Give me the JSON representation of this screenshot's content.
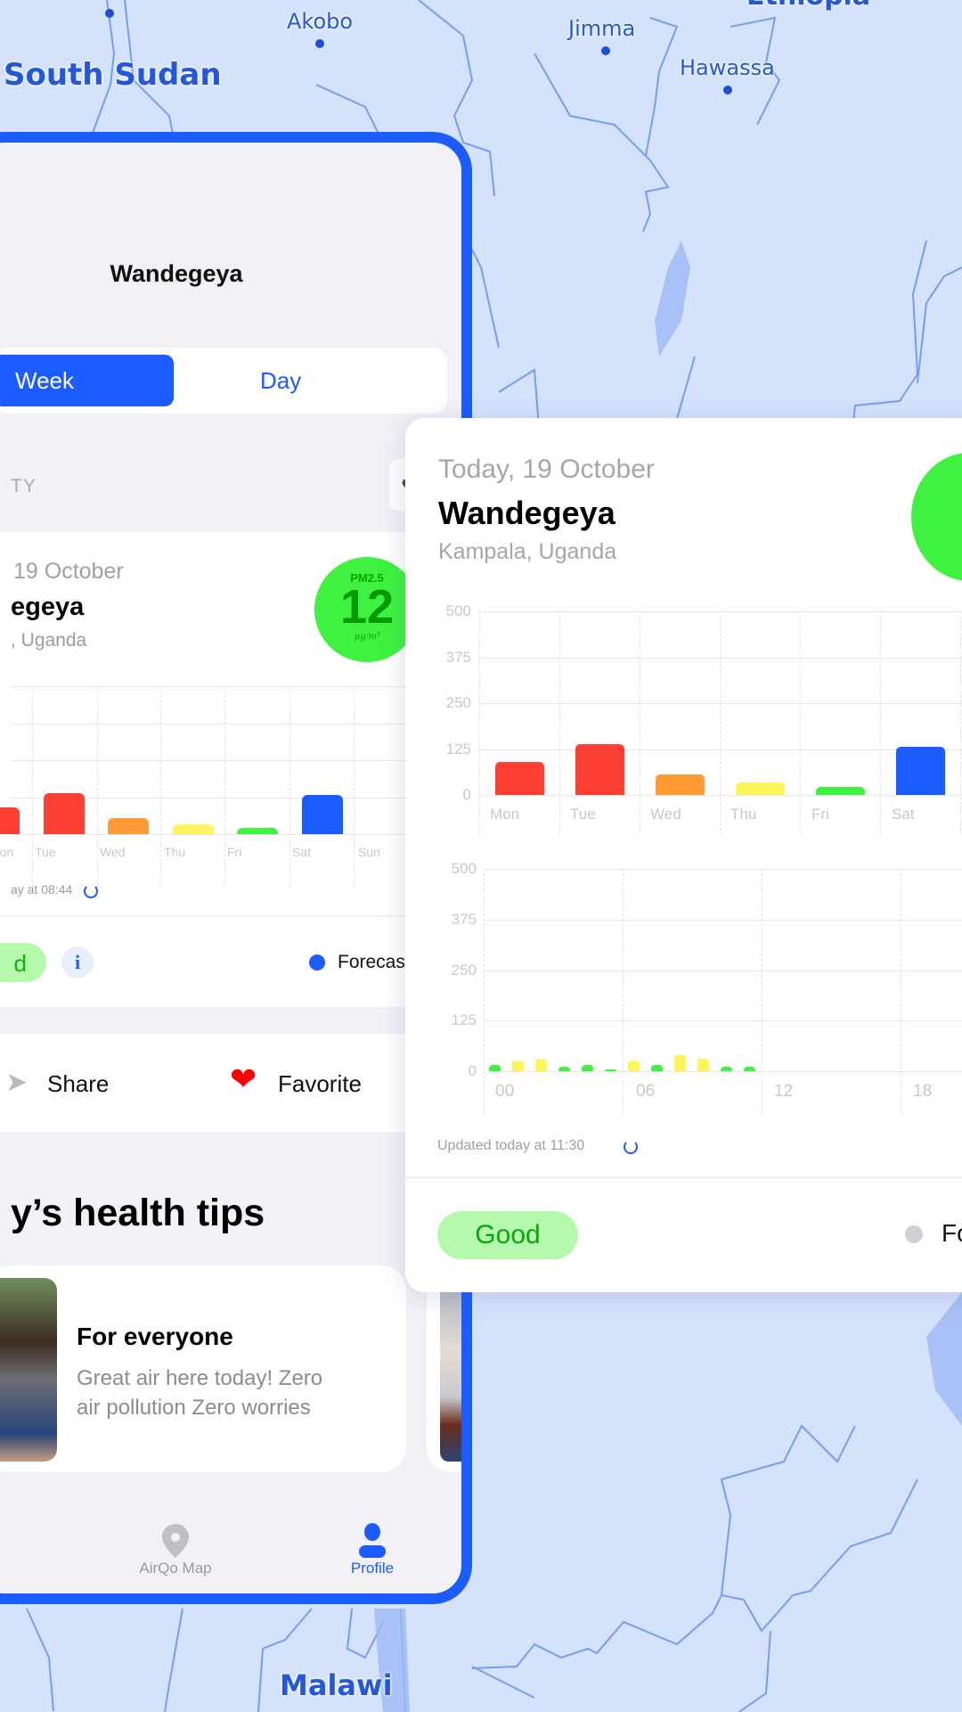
{
  "map": {
    "labels": {
      "south_sudan": "South Sudan",
      "akobo": "Akobo",
      "jimma": "Jimma",
      "hawassa": "Hawassa",
      "ethiopia": "Ethiopia",
      "malawi": "Malawi"
    },
    "colors": {
      "water": "#d5e2fc",
      "border": "#5f8cf0",
      "label": "#2458d8"
    }
  },
  "phone": {
    "location_title": "Wandegeya",
    "toggle": {
      "week": "Week",
      "day": "Day",
      "selected": "Week"
    },
    "section_label": "TY",
    "card": {
      "date": "19 October",
      "name": "egeya",
      "region": ", Uganda",
      "pm_label": "PM2.5",
      "pm_value": "12",
      "pm_unit": "µg/m³",
      "updated": "ay at 08:44",
      "status": "d",
      "forecast": "Forecast"
    },
    "actions": {
      "share": "Share",
      "favorite": "Favorite"
    },
    "tips_heading": "y’s health tips",
    "tip": {
      "title": "For everyone",
      "body_line1": "Great air here today! Zero",
      "body_line2": "air pollution Zero worries"
    },
    "nav": {
      "map": "AirQo Map",
      "profile": "Profile"
    }
  },
  "detail": {
    "date": "Today, 19 October",
    "name": "Wandegeya",
    "region": "Kampala, Uganda",
    "updated": "Updated today at 11:30",
    "status": "Good",
    "forecast": "Fo"
  },
  "colors": {
    "accent": "#1a5cff",
    "good": "#3ff23f",
    "good_pill": "#b4f9ac",
    "moderate": "#fdf55b",
    "usg": "#ff9a35",
    "unhealthy": "#ff4133",
    "forecast": "#1a5cff"
  },
  "chart_data": [
    {
      "type": "bar",
      "categories": [
        "Mon",
        "Tue",
        "Wed",
        "Thu",
        "Fri",
        "Sat",
        "Sun"
      ],
      "values": [
        91,
        139,
        55,
        34,
        22,
        132,
        null
      ],
      "colors": [
        "#ff4133",
        "#ff4133",
        "#ff9a35",
        "#fdf55b",
        "#3ff23f",
        "#1a5cff",
        null
      ],
      "yticks": [
        "500",
        "375",
        "250",
        "125",
        "0"
      ],
      "ylim": [
        0,
        500
      ],
      "grid": true
    },
    {
      "type": "bar",
      "categories": [
        "00",
        "06",
        "12",
        "18"
      ],
      "x": [
        0,
        1,
        2,
        3,
        4,
        5,
        6,
        7,
        8,
        9,
        10,
        11
      ],
      "values": [
        15,
        26,
        30,
        10,
        15,
        5,
        26,
        15,
        40,
        30,
        10,
        10
      ],
      "colors": [
        "#3ff23f",
        "#fdf55b",
        "#fdf55b",
        "#3ff23f",
        "#3ff23f",
        "#3ff23f",
        "#fdf55b",
        "#3ff23f",
        "#fdf55b",
        "#fdf55b",
        "#3ff23f",
        "#3ff23f"
      ],
      "yticks": [
        "500",
        "375",
        "250",
        "125",
        "0"
      ],
      "ylim": [
        0,
        500
      ],
      "grid": true
    }
  ]
}
